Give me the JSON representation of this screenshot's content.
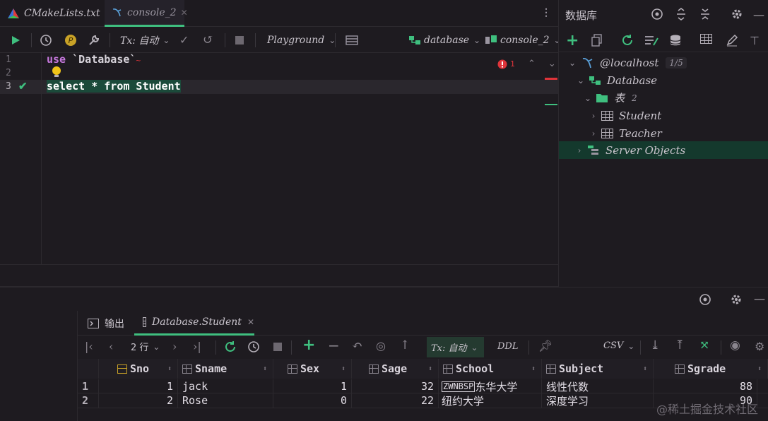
{
  "tabs": [
    {
      "label": "CMakeLists.txt",
      "icon": "cmake-icon"
    },
    {
      "label": "console_2",
      "icon": "mysql-dolphin-icon",
      "active": true
    }
  ],
  "toolbar": {
    "tx_label": "Tx: 自动",
    "playground_label": "Playground",
    "datasource_label": "database",
    "console_label": "console_2"
  },
  "editor": {
    "line_numbers": [
      "1",
      "2",
      "3"
    ],
    "line1_kw": "use",
    "line1_str": "`Database`",
    "line3": "select * from Student",
    "error_count": "1"
  },
  "dbpanel": {
    "title": "数据库",
    "host_label": "@localhost",
    "host_badge": "1/5",
    "database_label": "Database",
    "tables_label": "表",
    "tables_count": "2",
    "table1": "Student",
    "table2": "Teacher",
    "server_objects": "Server Objects"
  },
  "bottom": {
    "output_tab": "输出",
    "result_tab": "Database.Student",
    "rows_label": "2 行",
    "tx_label": "Tx: 自动",
    "ddl_label": "DDL",
    "csv_label": "CSV"
  },
  "grid": {
    "columns": [
      "Sno",
      "Sname",
      "Sex",
      "Sage",
      "School",
      "Subject",
      "Sgrade"
    ],
    "rows": [
      {
        "n": "1",
        "Sno": "1",
        "Sname": "jack",
        "Sex": "1",
        "Sage": "32",
        "School_prefix": "ZWNBSP",
        "School": "东华大学",
        "Subject": "线性代数",
        "Sgrade": "88"
      },
      {
        "n": "2",
        "Sno": "2",
        "Sname": "Rose",
        "Sex": "0",
        "Sage": "22",
        "School_prefix": "",
        "School": "纽约大学",
        "Subject": "深度学习",
        "Sgrade": "90"
      }
    ]
  },
  "watermark": "@稀土掘金技术社区",
  "colors": {
    "accent": "#3fbf7f",
    "keyword": "#c678dd",
    "error": "#e0343a"
  }
}
